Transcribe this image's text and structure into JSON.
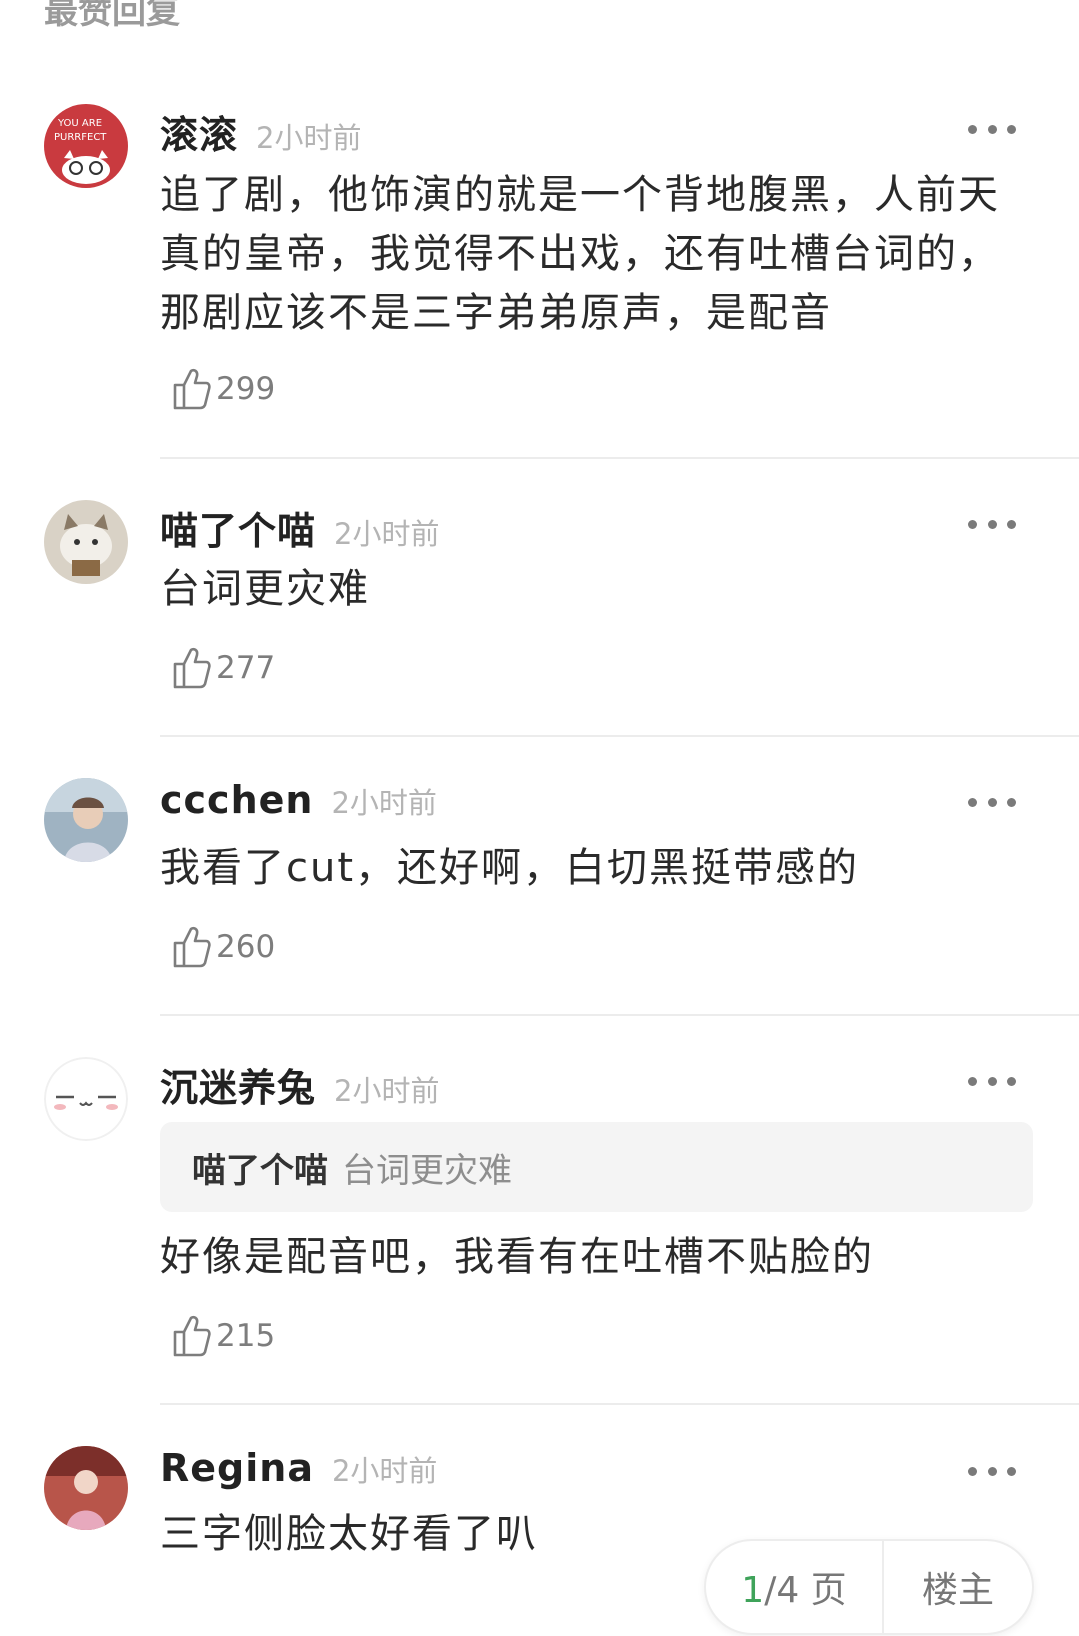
{
  "section_title": "最赞回复",
  "comments": [
    {
      "username": "滚滚",
      "time": "2小时前",
      "text": "追了剧，他饰演的就是一个背地腹黑，人前天真的皇帝，我觉得不出戏，还有吐槽台词的，那剧应该不是三字弟弟原声，是配音",
      "likes": "299"
    },
    {
      "username": "喵了个喵",
      "time": "2小时前",
      "text": "台词更灾难",
      "likes": "277"
    },
    {
      "username": "ccchen",
      "time": "2小时前",
      "text": "我看了cut，还好啊，白切黑挺带感的",
      "likes": "260"
    },
    {
      "username": "沉迷养兔",
      "time": "2小时前",
      "quote": {
        "name": "喵了个喵",
        "text": "台词更灾难"
      },
      "text": "好像是配音吧，我看有在吐槽不贴脸的",
      "likes": "215"
    },
    {
      "username": "Regina",
      "time": "2小时前",
      "text": "三字侧脸太好看了叭"
    }
  ],
  "pager": {
    "current": "1",
    "total_label": "/4 页",
    "owner_label": "楼主"
  },
  "icons": {
    "like": "thumbs-up-icon",
    "more": "more-dots-icon"
  },
  "colors": {
    "accent_green": "#3fa35a",
    "time_gray": "#b4b4b4",
    "text_dark": "#2a2a2a"
  }
}
